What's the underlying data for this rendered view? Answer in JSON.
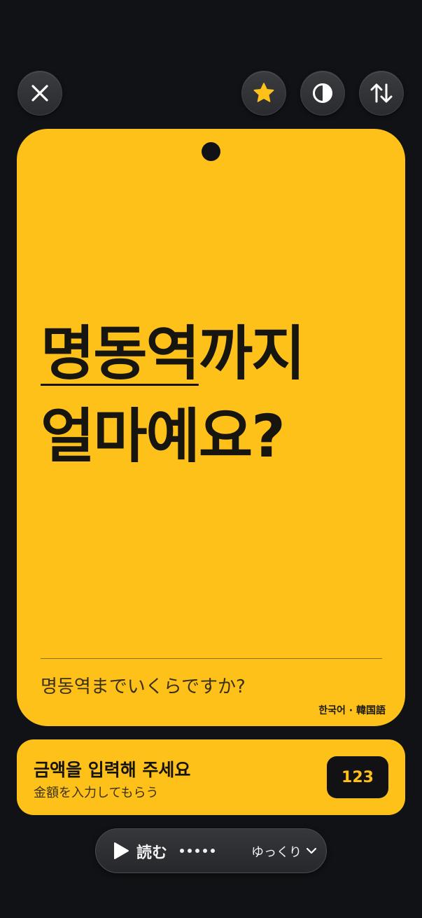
{
  "toolbar": {
    "close_icon": "close-icon",
    "favorite_icon": "star-icon",
    "contrast_icon": "contrast-icon",
    "swap_icon": "swap-direction-icon",
    "accent_color": "#fec11a"
  },
  "card": {
    "phrase_line1_underlined": "명동역",
    "phrase_line1_rest": "까지",
    "phrase_line2": "얼마예요?",
    "translation": "명동역までいくらですか?",
    "language_tag": "한국어 · 韓国語",
    "background_color": "#fec11a"
  },
  "input_prompt": {
    "title": "금액을 입력해 주세요",
    "subtitle": "金額を入力してもらう",
    "number_button_label": "123"
  },
  "player": {
    "play_icon": "play-icon",
    "read_label": "読む",
    "dot_count": 5,
    "speed_label": "ゆっくり",
    "speed_icon": "chevron-down-icon"
  }
}
